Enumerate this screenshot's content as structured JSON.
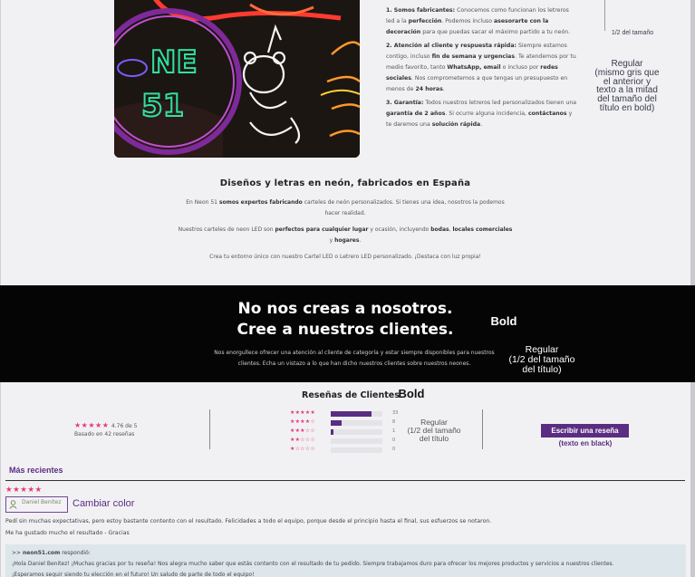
{
  "features": {
    "item1_title": "1. Somos fabricantes:",
    "item1_text_a": "Conocemos como funcionan los letreros led a la",
    "item1_bold_a": "perfección",
    "item1_text_b": ". Podemos incluso",
    "item1_bold_b": "asesorarte con la decoración",
    "item1_text_c": "para que puedas sacar el máximo partido a tu neón.",
    "item2_title": "2. Atención al cliente y respuesta rápida:",
    "item2_text_a": "Siempre estamos contigo, incluso",
    "item2_bold_a": "fin de semana y urgencias",
    "item2_text_b": ". Te atendemos por tu medio favorito, tanto",
    "item2_bold_b": "WhatsApp, email",
    "item2_text_c": "o incluso por",
    "item2_bold_c": "redes sociales",
    "item2_text_d": ". Nos comprometemos a que tengas un presupuesto en menos de",
    "item2_bold_d": "24 horas",
    "item2_text_e": ".",
    "item3_title": "3. Garantía:",
    "item3_text_a": "Todos nuestros letreros led personalizados tienen una",
    "item3_bold_a": "garantía de 2 años",
    "item3_text_b": ". Si ocurre alguna incidencia,",
    "item3_bold_b": "contáctanos",
    "item3_text_c": "y te daremos una",
    "item3_bold_c": "solución rápida",
    "item3_text_d": "."
  },
  "annotations": {
    "half_size": "1/2 del tamaño",
    "regular_gray": "Regular\n(mismo gris que\nel anterior y\ntexto a la mitad\ndel tamaño del\ntítulo en bold)",
    "bold": "Bold",
    "regular_half": "Regular\n(1/2 del tamaño\ndel título)",
    "bold2": "Bold",
    "regular_half2": "Regular\n(1/2 del tamaño\ndel título",
    "btn_note": "(texto en black)",
    "change_color": "Cambiar color"
  },
  "intro": {
    "title": "Diseños y letras en neón, fabricados en España",
    "p1_a": "En Neon 51",
    "p1_b": "somos expertos fabricando",
    "p1_c": "carteles de neón personalizados. Si tienes una idea, nosotros la podemos hacer realidad.",
    "p2_a": "Nuestros carteles de neon LED son",
    "p2_b": "perfectos para cualquier lugar",
    "p2_c": "y ocasión, incluyendo",
    "p2_d": "bodas",
    "p2_e": ",",
    "p2_f": "locales comerciales",
    "p2_g": "y",
    "p2_h": "hogares",
    "p2_i": ".",
    "p3": "Crea tu entorno único con nuestro Cartel LED o Letrero LED personalizado. ¡Destaca con luz propia!"
  },
  "band": {
    "title": "No nos creas a nosotros. Cree a nuestros clientes.",
    "text": "Nos enorgullece ofrecer una atención al cliente de categoría y estar siempre disponibles para nuestros clientes. Echa un vistazo a lo que han dicho nuestros clientes sobre nuestros neones."
  },
  "reviews": {
    "title": "Reseñas de Clientes",
    "summary_stars": "★★★★★",
    "rating": "4.76 de 5",
    "based_on": "Basado en 42 reseñas",
    "bars": [
      {
        "stars": "★★★★★",
        "count": "33",
        "fill": 0.79
      },
      {
        "stars": "★★★★☆",
        "count": "8",
        "fill": 0.21
      },
      {
        "stars": "★★★☆☆",
        "count": "1",
        "fill": 0.05
      },
      {
        "stars": "★★☆☆☆",
        "count": "0",
        "fill": 0
      },
      {
        "stars": "★☆☆☆☆",
        "count": "0",
        "fill": 0
      }
    ],
    "write_button": "Escribir una reseña",
    "tab_recent": "Más recientes",
    "item": {
      "stars": "★★★★★",
      "author": "Daniel Benitez",
      "line1": "Pedí sin muchas expectativas, pero estoy bastante contento con el resultado. Felicidades a todo el equipo, porque desde el principio hasta el final, sus esfuerzos se notaron.",
      "line2": "Me ha gustado mucho el resultado - Gracias",
      "reply_prefix": ">>",
      "reply_site": "neon51.com",
      "reply_label": "respondió:",
      "reply_text": "¡Hola Daniel Benitez! ¡Muchas gracias por tu reseña! Nos alegra mucho saber que estás contento con el resultado de tu pedido. Siempre trabajamos duro para ofrecer los mejores productos y servicios a nuestros clientes.",
      "reply_text2": "¡Esperamos seguir siendo tu elección en el futuro! Un saludo de parte de todo el equipo!"
    }
  },
  "colors": {
    "accent": "#5b2d82",
    "star": "#e6387a",
    "band": "#050505"
  }
}
